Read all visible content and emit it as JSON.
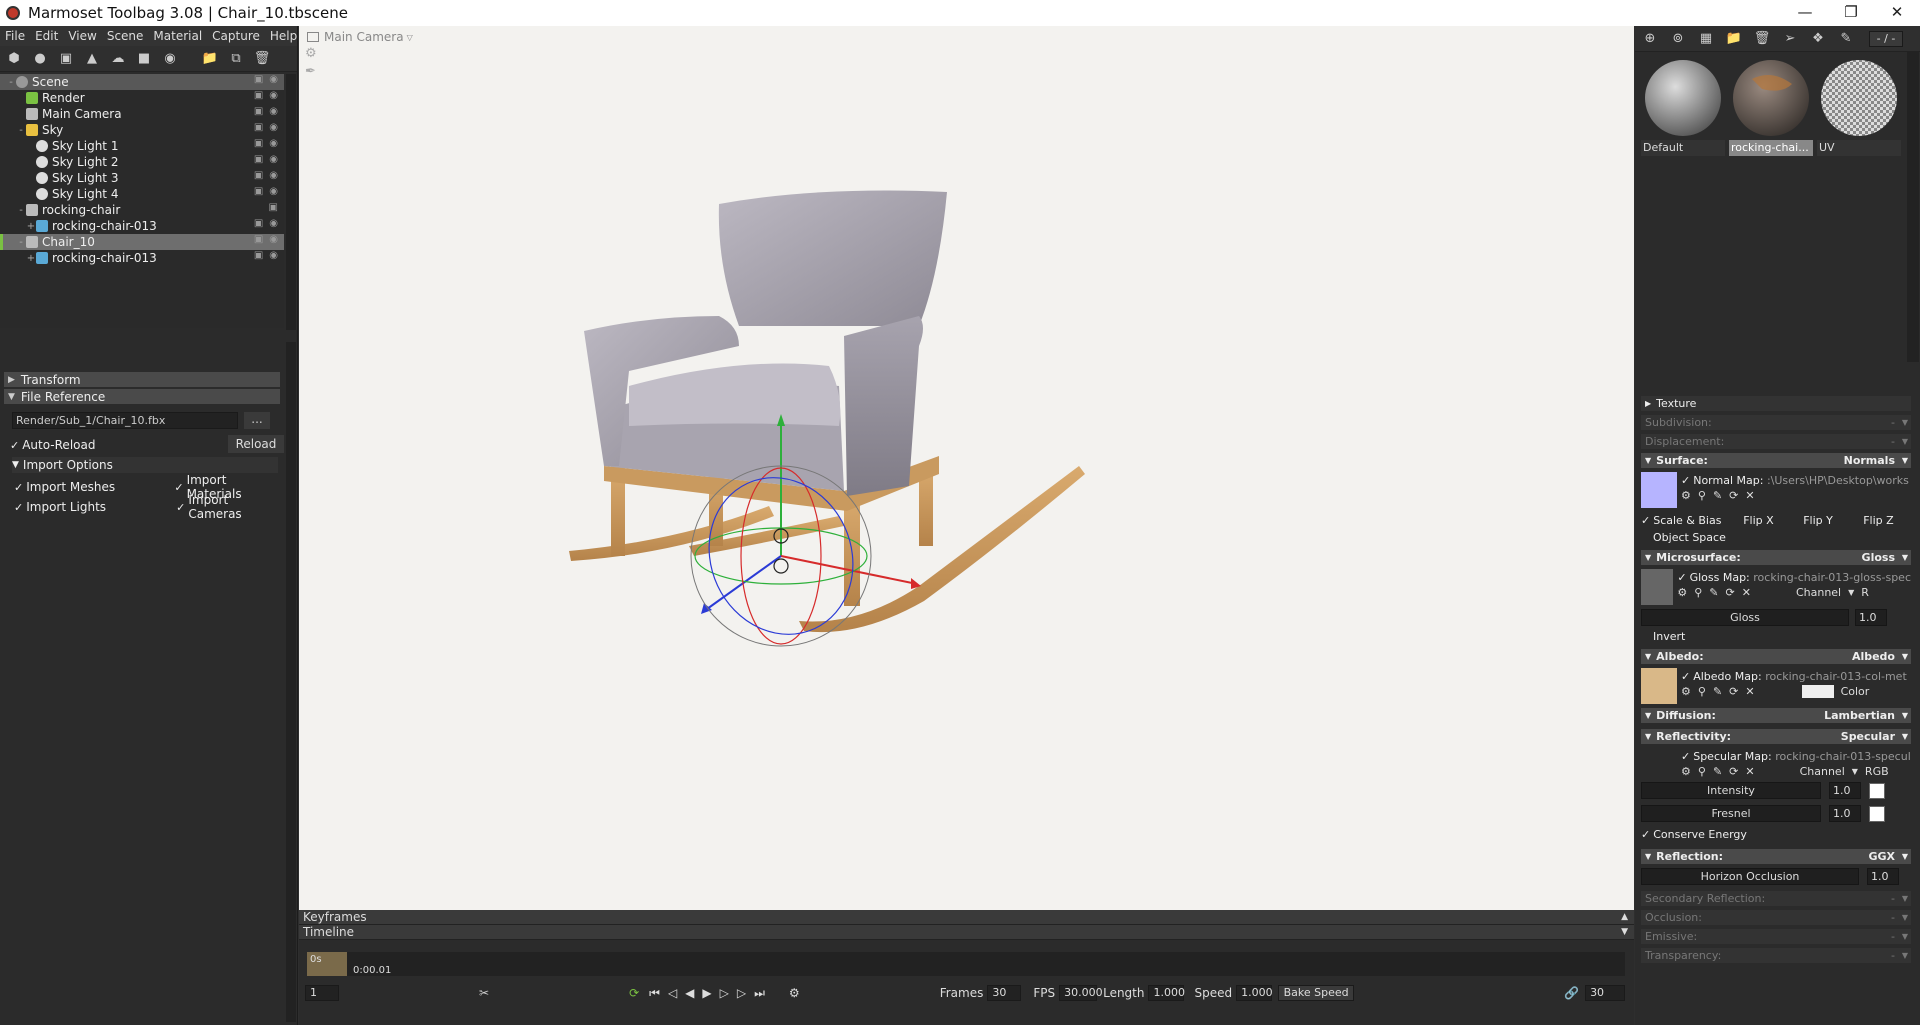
{
  "window": {
    "title": "Marmoset Toolbag 3.08  |  Chair_10.tbscene"
  },
  "menu": [
    "File",
    "Edit",
    "View",
    "Scene",
    "Material",
    "Capture",
    "Help"
  ],
  "scene_tree": [
    {
      "label": "Scene",
      "depth": 0,
      "pm": "-",
      "icon": "scene"
    },
    {
      "label": "Render",
      "depth": 1,
      "pm": "",
      "icon": "render"
    },
    {
      "label": "Main Camera",
      "depth": 1,
      "pm": "",
      "icon": "camera"
    },
    {
      "label": "Sky",
      "depth": 1,
      "pm": "-",
      "icon": "sky"
    },
    {
      "label": "Sky Light 1",
      "depth": 2,
      "pm": "",
      "icon": "light"
    },
    {
      "label": "Sky Light 2",
      "depth": 2,
      "pm": "",
      "icon": "light"
    },
    {
      "label": "Sky Light 3",
      "depth": 2,
      "pm": "",
      "icon": "light"
    },
    {
      "label": "Sky Light 4",
      "depth": 2,
      "pm": "",
      "icon": "light"
    },
    {
      "label": "rocking-chair",
      "depth": 1,
      "pm": "-",
      "icon": "ref"
    },
    {
      "label": "rocking-chair-013",
      "depth": 2,
      "pm": "+",
      "icon": "mesh"
    },
    {
      "label": "Chair_10",
      "depth": 1,
      "pm": "-",
      "icon": "ref"
    },
    {
      "label": "rocking-chair-013",
      "depth": 2,
      "pm": "+",
      "icon": "mesh"
    }
  ],
  "props": {
    "transform": "Transform",
    "file_reference": "File Reference",
    "file_path": "Render/Sub_1/Chair_10.fbx",
    "browse": "...",
    "auto_reload": "Auto-Reload",
    "reload": "Reload",
    "import_options": "Import Options",
    "import_meshes": "Import Meshes",
    "import_materials": "Import Materials",
    "import_lights": "Import Lights",
    "import_cameras": "Import Cameras"
  },
  "viewport": {
    "camera": "Main Camera"
  },
  "timeline": {
    "keyframes": "Keyframes",
    "timeline": "Timeline",
    "cursor_label": "0s",
    "time": "0:00.01",
    "frame": "1",
    "frames_label": "Frames",
    "frames": "30",
    "fps_label": "FPS",
    "fps": "30.000",
    "length_label": "Length",
    "length": "1.000",
    "speed_label": "Speed",
    "speed": "1.000",
    "bake_speed": "Bake Speed",
    "end": "30"
  },
  "materials": {
    "page": "- / -",
    "items": [
      {
        "name": "Default",
        "selected": false
      },
      {
        "name": "rocking-chai...",
        "selected": true
      },
      {
        "name": "UV",
        "selected": false
      }
    ]
  },
  "mat": {
    "texture": "Texture",
    "subdivision": "Subdivision:",
    "dash": "-",
    "displacement": "Displacement:",
    "surface": "Surface:",
    "surface_val": "Normals",
    "normal_map": "Normal Map:",
    "normal_path": ":\\Users\\HP\\Desktop\\works",
    "scale_bias": "Scale & Bias",
    "flip_x": "Flip X",
    "flip_y": "Flip Y",
    "flip_z": "Flip Z",
    "object_space": "Object Space",
    "microsurface": "Microsurface:",
    "microsurface_val": "Gloss",
    "gloss_map": "Gloss Map:",
    "gloss_path": "rocking-chair-013-gloss-spec",
    "channel": "Channel",
    "channel_r": "R",
    "gloss": "Gloss",
    "gloss_val": "1.0",
    "invert": "Invert",
    "albedo": "Albedo:",
    "albedo_val": "Albedo",
    "albedo_map": "Albedo Map:",
    "albedo_path": "rocking-chair-013-col-met",
    "color": "Color",
    "diffusion": "Diffusion:",
    "diffusion_val": "Lambertian",
    "reflectivity": "Reflectivity:",
    "reflectivity_val": "Specular",
    "specular_map": "Specular Map:",
    "specular_path": "rocking-chair-013-specul",
    "channel_rgb": "RGB",
    "intensity": "Intensity",
    "intensity_val": "1.0",
    "fresnel": "Fresnel",
    "fresnel_val": "1.0",
    "conserve_energy": "Conserve Energy",
    "reflection": "Reflection:",
    "reflection_val": "GGX",
    "horizon_occlusion": "Horizon Occlusion",
    "horizon_val": "1.0",
    "secondary_reflection": "Secondary Reflection:",
    "occlusion": "Occlusion:",
    "emissive": "Emissive:",
    "transparency": "Transparency:"
  }
}
